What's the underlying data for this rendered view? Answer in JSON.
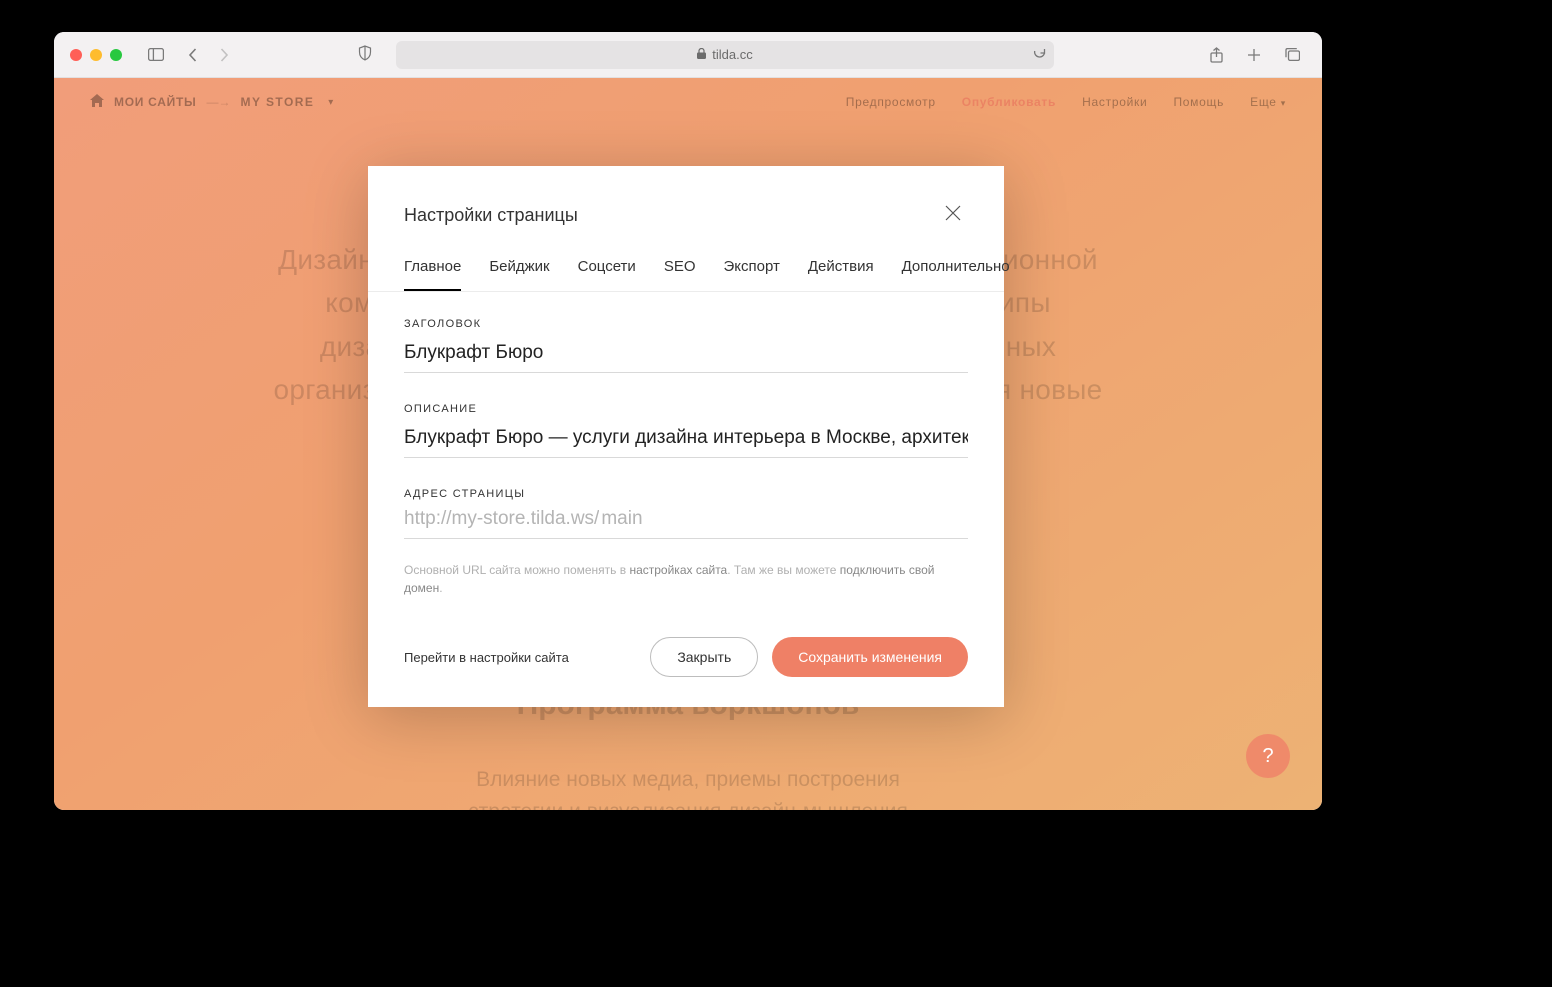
{
  "browser": {
    "url": "tilda.cc"
  },
  "topbar": {
    "crumb1": "МОИ САЙТЫ",
    "crumb2": "MY STORE",
    "nav": {
      "preview": "Предпросмотр",
      "publish": "Опубликовать",
      "settings": "Настройки",
      "help": "Помощь",
      "more": "Еще"
    }
  },
  "background": {
    "hero_l1": "Дизайн-менеджмент как ресурс для создания инновационной",
    "hero_l2": "компании, которая понимает, как применить принципы",
    "hero_l3": "дизайна для решения бизнес-проблем. В современных",
    "hero_l4": "организациях дизайнеры — новая элита, исследующая новые",
    "heading": "Программа воркшопов",
    "sub_l1": "Влияние новых медиа, приемы построения",
    "sub_l2": "стратегии и визуализация дизайн-мышления"
  },
  "modal": {
    "title": "Настройки страницы",
    "tabs": {
      "main": "Главное",
      "badge": "Бейджик",
      "social": "Соцсети",
      "seo": "SEO",
      "export": "Экспорт",
      "actions": "Действия",
      "advanced": "Дополнительно"
    },
    "fields": {
      "title_label": "ЗАГОЛОВОК",
      "title_value": "Блукрафт Бюро",
      "desc_label": "ОПИСАНИЕ",
      "desc_value": "Блукрафт Бюро — услуги дизайна интерьера в Москве, архитектуры",
      "url_label": "АДРЕС СТРАНИЦЫ",
      "url_prefix": "http://my-store.tilda.ws/",
      "url_value": "main"
    },
    "help": {
      "part1": "Основной URL сайта можно поменять в ",
      "link1": "настройках сайта",
      "part2": ". Там же вы можете ",
      "link2": "подключить свой домен",
      "part3": "."
    },
    "footer": {
      "site_settings": "Перейти в настройки сайта",
      "close": "Закрыть",
      "save": "Сохранить изменения"
    }
  },
  "help_fab": "?"
}
